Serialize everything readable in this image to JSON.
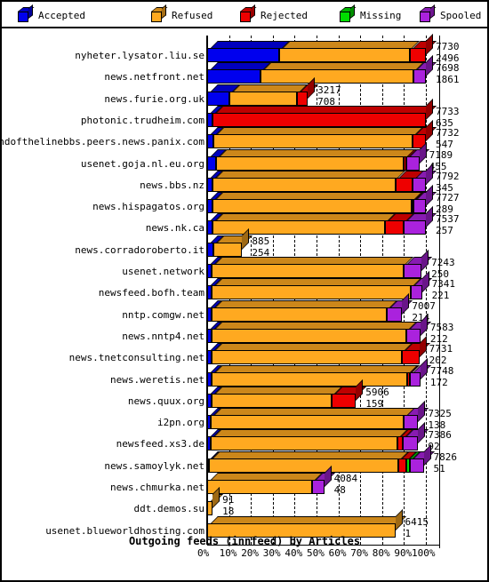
{
  "legend": {
    "items": [
      {
        "label": "Accepted",
        "color": "#0000EE",
        "icon": "cube-icon"
      },
      {
        "label": "Refused",
        "color": "#FFA920",
        "icon": "cube-icon"
      },
      {
        "label": "Rejected",
        "color": "#EE0000",
        "icon": "cube-icon"
      },
      {
        "label": "Missing",
        "color": "#00DD00",
        "icon": "cube-icon"
      },
      {
        "label": "Spooled",
        "color": "#AA22DD",
        "icon": "cube-icon"
      }
    ]
  },
  "axis": {
    "ticks": [
      "0%",
      "10%",
      "20%",
      "30%",
      "40%",
      "50%",
      "60%",
      "70%",
      "80%",
      "90%",
      "100%"
    ]
  },
  "chart_data": {
    "type": "bar",
    "title": "Outgoing feeds (innfeed) by Articles",
    "xlabel": "",
    "ylabel": "",
    "orientation": "horizontal",
    "stacked": true,
    "normalized": true,
    "xlim": [
      0,
      100
    ],
    "xtick_labels": [
      "0%",
      "10%",
      "20%",
      "30%",
      "40%",
      "50%",
      "60%",
      "70%",
      "80%",
      "90%",
      "100%"
    ],
    "grid": true,
    "legend_position": "top",
    "series": [
      {
        "name": "Accepted",
        "color": "#0000EE"
      },
      {
        "name": "Refused",
        "color": "#FFA920"
      },
      {
        "name": "Rejected",
        "color": "#EE0000"
      },
      {
        "name": "Missing",
        "color": "#00DD00"
      },
      {
        "name": "Spooled",
        "color": "#AA22DD"
      }
    ],
    "categories": [
      "nyheter.lysator.liu.se",
      "news.netfront.net",
      "news.furie.org.uk",
      "photonic.trudheim.com",
      "endofthelinebbs.peers.news.panix.com",
      "usenet.goja.nl.eu.org",
      "news.bbs.nz",
      "news.hispagatos.org",
      "news.nk.ca",
      "news.corradoroberto.it",
      "usenet.network",
      "newsfeed.bofh.team",
      "nntp.comgw.net",
      "news.nntp4.net",
      "news.tnetconsulting.net",
      "news.weretis.net",
      "news.quux.org",
      "i2pn.org",
      "newsfeed.xs3.de",
      "news.samoylyk.net",
      "news.chmurka.net",
      "ddt.demos.su",
      "usenet.blueworldhosting.com"
    ],
    "rows": [
      {
        "label": "nyheter.lysator.liu.se",
        "total": 7730,
        "value2": 2496,
        "pct": {
          "accepted": 33.0,
          "refused": 59.5,
          "rejected": 7.5,
          "missing": 0.0,
          "spooled": 0.0
        }
      },
      {
        "label": "news.netfront.net",
        "total": 7698,
        "value2": 1861,
        "pct": {
          "accepted": 24.2,
          "refused": 70.0,
          "rejected": 0.0,
          "missing": 0.0,
          "spooled": 5.8
        }
      },
      {
        "label": "news.furie.org.uk",
        "total": 3217,
        "value2": 708,
        "pct": {
          "accepted": 10.0,
          "refused": 31.0,
          "rejected": 5.0,
          "missing": 0.0,
          "spooled": 0.0
        }
      },
      {
        "label": "photonic.trudheim.com",
        "total": 7733,
        "value2": 635,
        "pct": {
          "accepted": 2.4,
          "refused": 0.0,
          "rejected": 97.6,
          "missing": 0.0,
          "spooled": 0.0
        }
      },
      {
        "label": "endofthelinebbs.peers.news.panix.com",
        "total": 7732,
        "value2": 547,
        "pct": {
          "accepted": 3.0,
          "refused": 91.0,
          "rejected": 6.0,
          "missing": 0.0,
          "spooled": 0.0
        }
      },
      {
        "label": "usenet.goja.nl.eu.org",
        "total": 7189,
        "value2": 455,
        "pct": {
          "accepted": 4.0,
          "refused": 86.0,
          "rejected": 1.2,
          "missing": 0.0,
          "spooled": 5.8
        }
      },
      {
        "label": "news.bbs.nz",
        "total": 7792,
        "value2": 345,
        "pct": {
          "accepted": 2.5,
          "refused": 83.5,
          "rejected": 8.0,
          "missing": 0.0,
          "spooled": 6.0
        }
      },
      {
        "label": "news.hispagatos.org",
        "total": 7727,
        "value2": 289,
        "pct": {
          "accepted": 2.6,
          "refused": 91.0,
          "rejected": 0.6,
          "missing": 0.0,
          "spooled": 5.8
        }
      },
      {
        "label": "news.nk.ca",
        "total": 7537,
        "value2": 257,
        "pct": {
          "accepted": 2.5,
          "refused": 79.0,
          "rejected": 8.5,
          "missing": 0.0,
          "spooled": 10.0
        }
      },
      {
        "label": "news.corradoroberto.it",
        "total": 885,
        "value2": 254,
        "pct": {
          "accepted": 3.0,
          "refused": 13.0,
          "rejected": 0.0,
          "missing": 0.0,
          "spooled": 0.0
        }
      },
      {
        "label": "usenet.network",
        "total": 7243,
        "value2": 250,
        "pct": {
          "accepted": 2.2,
          "refused": 87.5,
          "rejected": 0.0,
          "missing": 0.0,
          "spooled": 8.3
        }
      },
      {
        "label": "newsfeed.bofh.team",
        "total": 7341,
        "value2": 221,
        "pct": {
          "accepted": 2.2,
          "refused": 91.0,
          "rejected": 0.0,
          "missing": 0.0,
          "spooled": 5.0
        }
      },
      {
        "label": "nntp.comgw.net",
        "total": 7007,
        "value2": 214,
        "pct": {
          "accepted": 2.2,
          "refused": 80.0,
          "rejected": 0.0,
          "missing": 0.0,
          "spooled": 7.0
        }
      },
      {
        "label": "news.nntp4.net",
        "total": 7583,
        "value2": 212,
        "pct": {
          "accepted": 2.0,
          "refused": 89.0,
          "rejected": 0.0,
          "missing": 0.0,
          "spooled": 6.5
        }
      },
      {
        "label": "news.tnetconsulting.net",
        "total": 7731,
        "value2": 202,
        "pct": {
          "accepted": 2.0,
          "refused": 87.0,
          "rejected": 8.0,
          "missing": 0.0,
          "spooled": 0.0
        }
      },
      {
        "label": "news.weretis.net",
        "total": 7748,
        "value2": 172,
        "pct": {
          "accepted": 2.0,
          "refused": 89.5,
          "rejected": 1.0,
          "missing": 0.0,
          "spooled": 5.0
        }
      },
      {
        "label": "news.quux.org",
        "total": 5906,
        "value2": 159,
        "pct": {
          "accepted": 2.0,
          "refused": 55.0,
          "rejected": 11.0,
          "missing": 0.0,
          "spooled": 0.0
        }
      },
      {
        "label": "i2pn.org",
        "total": 7325,
        "value2": 138,
        "pct": {
          "accepted": 1.5,
          "refused": 88.5,
          "rejected": 0.0,
          "missing": 0.0,
          "spooled": 6.5
        }
      },
      {
        "label": "newsfeed.xs3.de",
        "total": 7386,
        "value2": 92,
        "pct": {
          "accepted": 1.5,
          "refused": 85.5,
          "rejected": 2.5,
          "missing": 0.0,
          "spooled": 7.0
        }
      },
      {
        "label": "news.samoylyk.net",
        "total": 7826,
        "value2": 51,
        "pct": {
          "accepted": 1.0,
          "refused": 86.5,
          "rejected": 3.5,
          "missing": 1.5,
          "spooled": 6.5
        }
      },
      {
        "label": "news.chmurka.net",
        "total": 4084,
        "value2": 48,
        "pct": {
          "accepted": 0.0,
          "refused": 48.0,
          "rejected": 0.0,
          "missing": 0.0,
          "spooled": 5.5
        }
      },
      {
        "label": "ddt.demos.su",
        "total": 91,
        "value2": 18,
        "pct": {
          "accepted": 0.0,
          "refused": 2.5,
          "rejected": 0.0,
          "missing": 0.0,
          "spooled": 0.0
        }
      },
      {
        "label": "usenet.blueworldhosting.com",
        "total": 6415,
        "value2": 1,
        "pct": {
          "accepted": 0.0,
          "refused": 86.0,
          "rejected": 0.0,
          "missing": 0.0,
          "spooled": 0.0
        }
      }
    ]
  }
}
